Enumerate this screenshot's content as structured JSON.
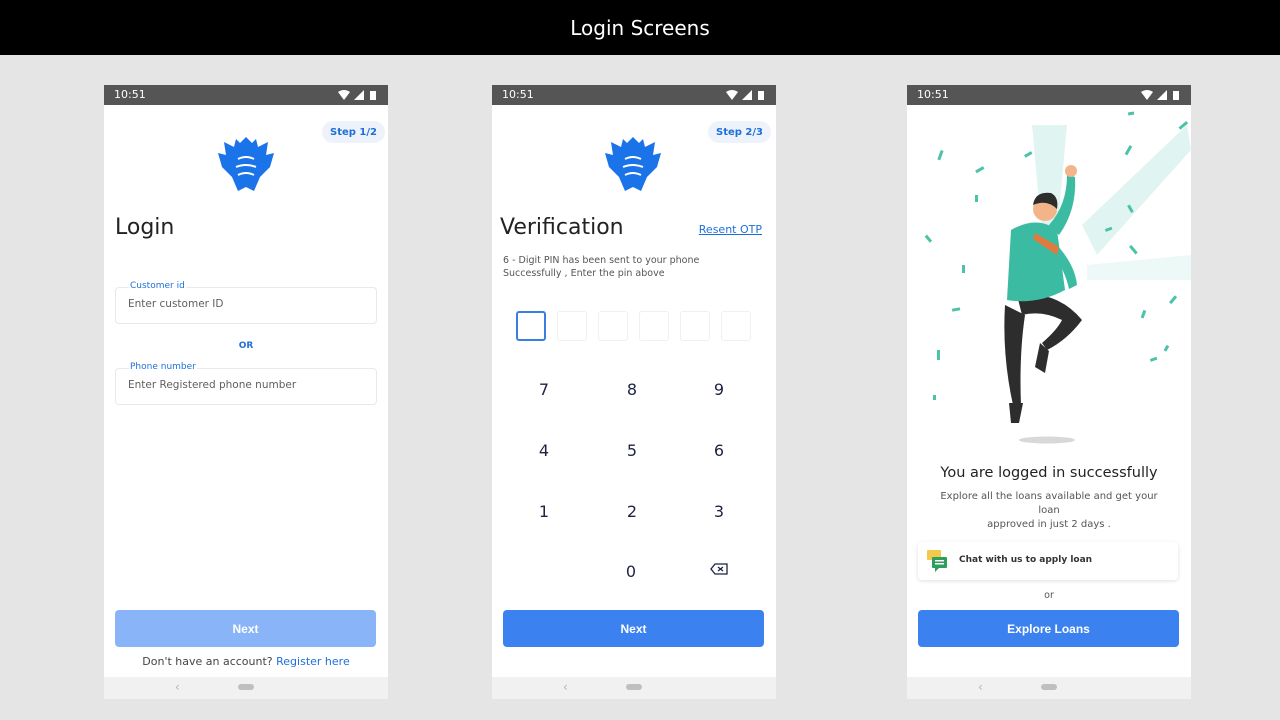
{
  "page": {
    "title": "Login Screens"
  },
  "colors": {
    "primary": "#3b82f0",
    "primary_disabled": "#8ab4f8",
    "accent_text": "#1e6fd9"
  },
  "status_bar": {
    "time": "10:51"
  },
  "login": {
    "step": "Step 1/2",
    "title": "Login",
    "customer_id_label": "Customer id",
    "customer_id_placeholder": "Enter customer ID",
    "or_label": "OR",
    "phone_label": "Phone number",
    "phone_placeholder": "Enter Registered phone number",
    "next_label": "Next",
    "no_account_text": "Don't have an account?",
    "register_link": "Register here"
  },
  "verification": {
    "step": "Step 2/3",
    "title": "Verification",
    "resend_link": "Resent OTP",
    "note_line1": "6 - Digit PIN has been sent to your phone",
    "note_line2": "Successfully , Enter the pin above",
    "keys": [
      "7",
      "8",
      "9",
      "4",
      "5",
      "6",
      "1",
      "2",
      "3",
      "0"
    ],
    "next_label": "Next"
  },
  "success": {
    "title": "You are logged in successfully",
    "subtitle_line1": "Explore all the loans available and get your loan",
    "subtitle_line2": "approved in just 2 days .",
    "chat_label": "Chat with us to apply loan",
    "or_label": "or",
    "explore_label": "Explore Loans"
  }
}
